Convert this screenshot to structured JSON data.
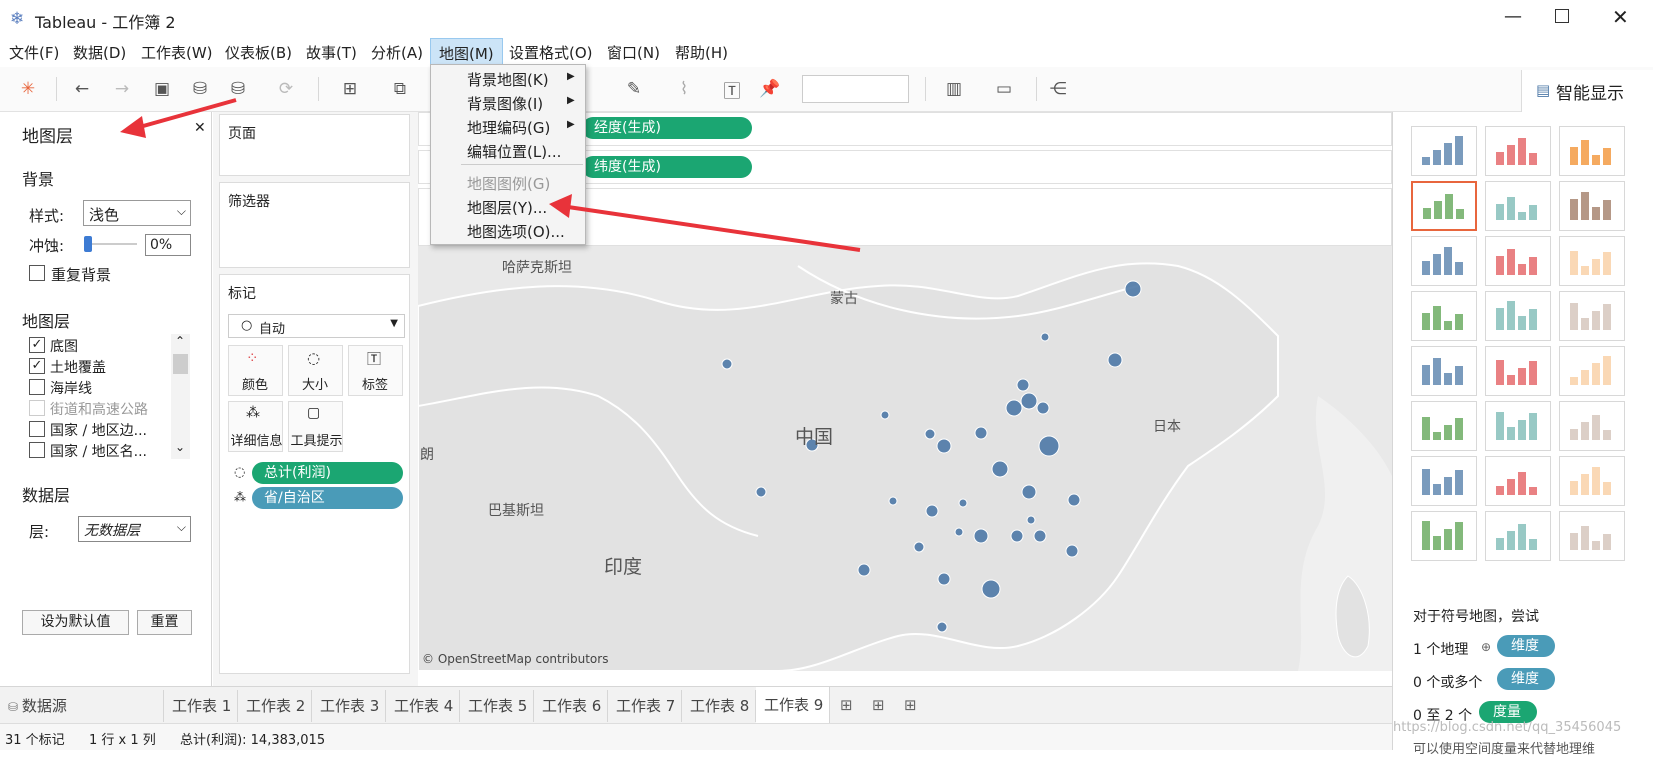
{
  "window": {
    "title": "Tableau - 工作簿 2"
  },
  "menu": [
    "文件(F)",
    "数据(D)",
    "工作表(W)",
    "仪表板(B)",
    "故事(T)",
    "分析(A)",
    "地图(M)",
    "设置格式(O)",
    "窗口(N)",
    "帮助(H)"
  ],
  "map_menu": {
    "items": [
      "背景地图(K)",
      "背景图像(I)",
      "地理编码(G)",
      "编辑位置(L)...",
      "地图图例(G)",
      "地图层(Y)...",
      "地图选项(O)..."
    ],
    "disabled": [
      "地图图例(G)"
    ]
  },
  "map_layers_panel": {
    "title": "地图层",
    "background_heading": "背景",
    "style_label": "样式:",
    "style_value": "浅色",
    "wash_label": "冲蚀:",
    "wash_value": "0%",
    "repeat_bg_label": "重复背景",
    "layers_heading": "地图层",
    "layers": [
      {
        "label": "底图",
        "checked": true
      },
      {
        "label": "土地覆盖",
        "checked": true
      },
      {
        "label": "海岸线",
        "checked": false
      },
      {
        "label": "街道和高速公路",
        "checked": false,
        "disabled": true
      },
      {
        "label": "国家 / 地区边...",
        "checked": false
      },
      {
        "label": "国家 / 地区名...",
        "checked": false
      }
    ],
    "data_layer_heading": "数据层",
    "layer_label": "层:",
    "layer_value": "无数据层",
    "set_default_button": "设为默认值",
    "reset_button": "重置"
  },
  "cards": {
    "pages": "页面",
    "filters": "筛选器",
    "marks": "标记",
    "mark_type": "自动",
    "mark_buttons": [
      "颜色",
      "大小",
      "标签",
      "详细信息",
      "工具提示"
    ],
    "mark_pills": [
      "总计(利润)",
      "省/自治区"
    ]
  },
  "shelves": {
    "columns_pill": "经度(生成)",
    "rows_pill": "纬度(生成)"
  },
  "map": {
    "labels": [
      "哈萨克斯坦",
      "蒙古",
      "中国",
      "日本",
      "朗",
      "巴基斯坦",
      "印度"
    ],
    "attribution": "© OpenStreetMap contributors"
  },
  "show_me": {
    "title": "智能显示",
    "hint_heading": "对于符号地图，尝试",
    "requirements": [
      {
        "prefix": "1 个地理",
        "badge": "维度"
      },
      {
        "prefix": "0 个或多个",
        "badge": "维度"
      },
      {
        "prefix": "0 至 2 个",
        "badge": "度量"
      }
    ],
    "footer_text": "可以使用空间度量来代替地理维"
  },
  "sheet_tabs": {
    "datasource": "数据源",
    "tabs": [
      "工作表 1",
      "工作表 2",
      "工作表 3",
      "工作表 4",
      "工作表 5",
      "工作表 6",
      "工作表 7",
      "工作表 8",
      "工作表 9"
    ],
    "active": "工作表 9"
  },
  "status": {
    "marks": "31 个标记",
    "dims": "1 行 x 1 列",
    "sum": "总计(利润): 14,383,015"
  },
  "watermark": "https://blog.csdn.net/qq_35456045",
  "colors": {
    "green_pill": "#1ba672",
    "teal_pill": "#4a9bb8",
    "map_dot": "#4e79a7",
    "arrow": "#e8333a"
  }
}
